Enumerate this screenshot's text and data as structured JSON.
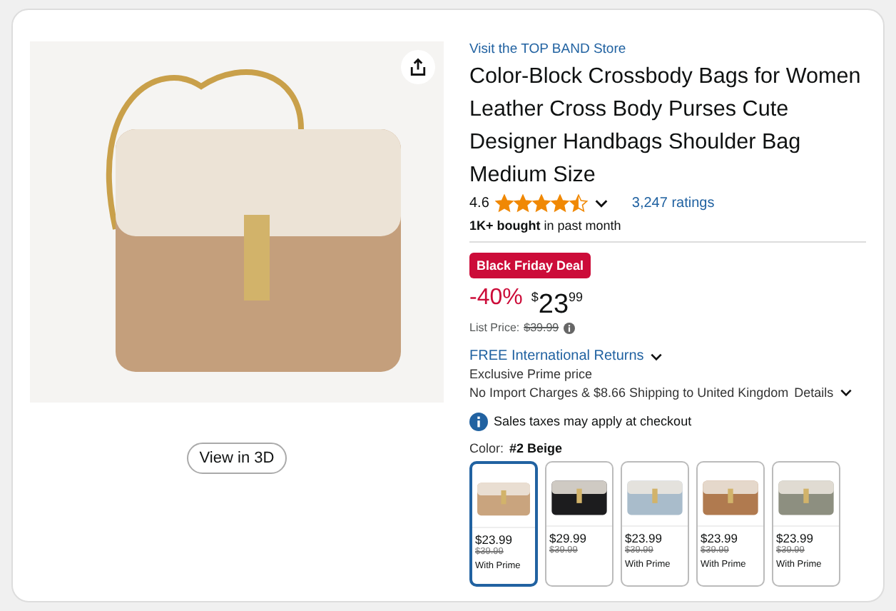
{
  "product": {
    "view_3d": "View in 3D",
    "store_link": "Visit the TOP BAND Store",
    "title": "Color-Block Crossbody Bags for Women Leather Cross Body Purses Cute Designer Handbags Shoulder Bag Medium Size",
    "rating": "4.6",
    "stars": 4.5,
    "ratings_count": "3,247 ratings",
    "bought_bold": "1K+ bought",
    "bought_rest": "in past month",
    "deal_badge": "Black Friday Deal",
    "discount": "-40%",
    "currency": "$",
    "price_whole": "23",
    "price_fraction": "99",
    "list_price_label": "List Price:",
    "list_price": "$39.99",
    "returns": "FREE International Returns",
    "prime_note": "Exclusive Prime price",
    "shipping": "No Import Charges & $8.66 Shipping to United Kingdom",
    "details_link": "Details",
    "tax_note": "Sales taxes may apply at checkout",
    "color_label": "Color:",
    "color_value": "#2 Beige"
  },
  "swatches": [
    {
      "price": "$23.99",
      "list_price": "$39.99",
      "note": "With Prime",
      "selected": true,
      "color": "#c9a47e"
    },
    {
      "price": "$29.99",
      "list_price": "$39.99",
      "selected": false,
      "color": "#1c1c1e"
    },
    {
      "price": "$23.99",
      "list_price": "$39.99",
      "note": "With Prime",
      "selected": false,
      "color": "#a9bccb"
    },
    {
      "price": "$23.99",
      "list_price": "$39.99",
      "note": "With Prime",
      "selected": false,
      "color": "#b07a4f"
    },
    {
      "price": "$23.99",
      "list_price": "$39.99",
      "note": "With Prime",
      "selected": false,
      "color": "#8d8f80"
    }
  ]
}
